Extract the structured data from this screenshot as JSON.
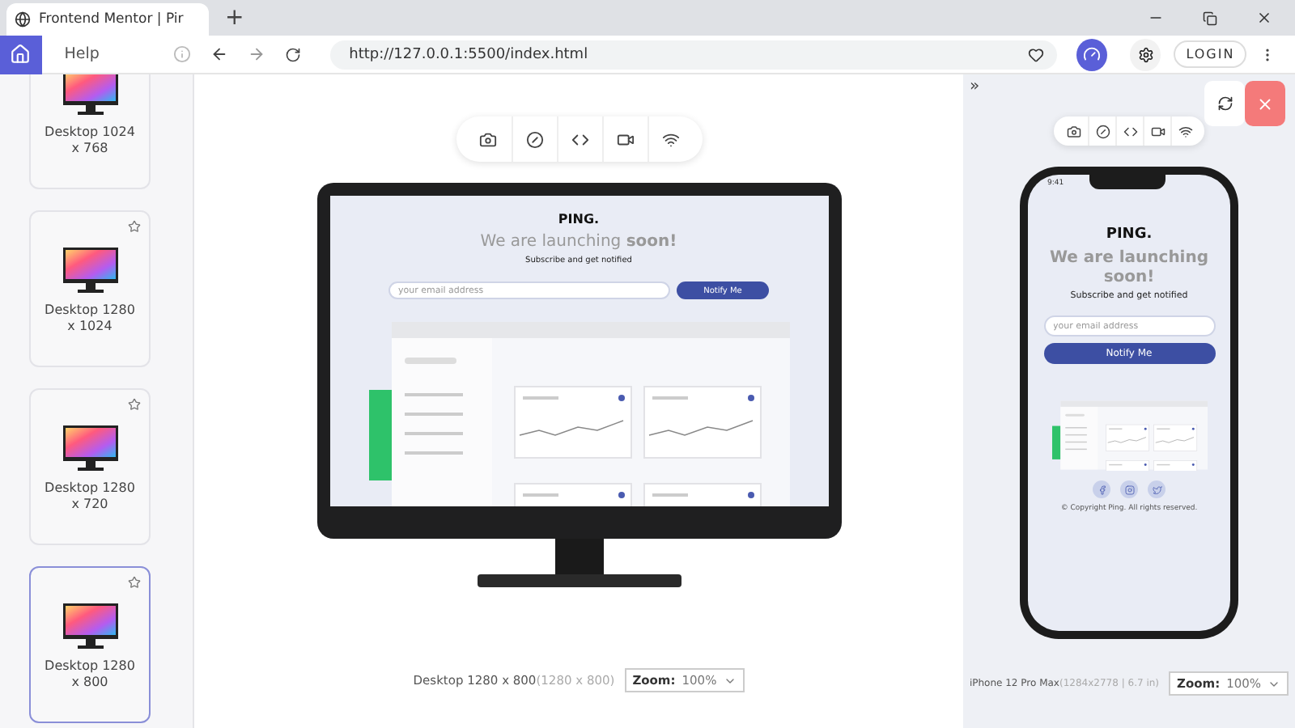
{
  "browser": {
    "tabs": [
      {
        "title": "Frontend Mentor | Pir",
        "selected": true
      }
    ],
    "new_tab": "+",
    "help": "Help",
    "url": "http://127.0.0.1:5500/index.html",
    "login": "LOGIN"
  },
  "devices": [
    {
      "label": "Desktop 1024 x 768",
      "selected": false
    },
    {
      "label": "Desktop 1280 x 1024",
      "selected": false
    },
    {
      "label": "Desktop 1280 x 720",
      "selected": false
    },
    {
      "label": "Desktop 1280 x 800",
      "selected": true
    }
  ],
  "desktop_preview": {
    "site": {
      "logo": "PING.",
      "headline": "We are launching **soon!**",
      "subtitle": "Subscribe and get notified",
      "email_placeholder": "your email address",
      "button": "Notify Me"
    },
    "caption": "Desktop 1280 x 800",
    "caption_size": "(1280 x 800)",
    "zoom_label": "Zoom:",
    "zoom_value": "100%"
  },
  "mobile_preview": {
    "expand": "»",
    "status_time": "9:41",
    "site": {
      "logo": "PING.",
      "headline": "We are launching **soon!**",
      "subtitle": "Subscribe and get notified",
      "email_placeholder": "your email address",
      "button": "Notify Me",
      "copyright": "© Copyright Ping. All rights reserved."
    },
    "caption": "iPhone 12 Pro Max",
    "caption_size": "(1284x2778 | 6.7 in)",
    "zoom_label": "Zoom:",
    "zoom_value": "100%"
  }
}
